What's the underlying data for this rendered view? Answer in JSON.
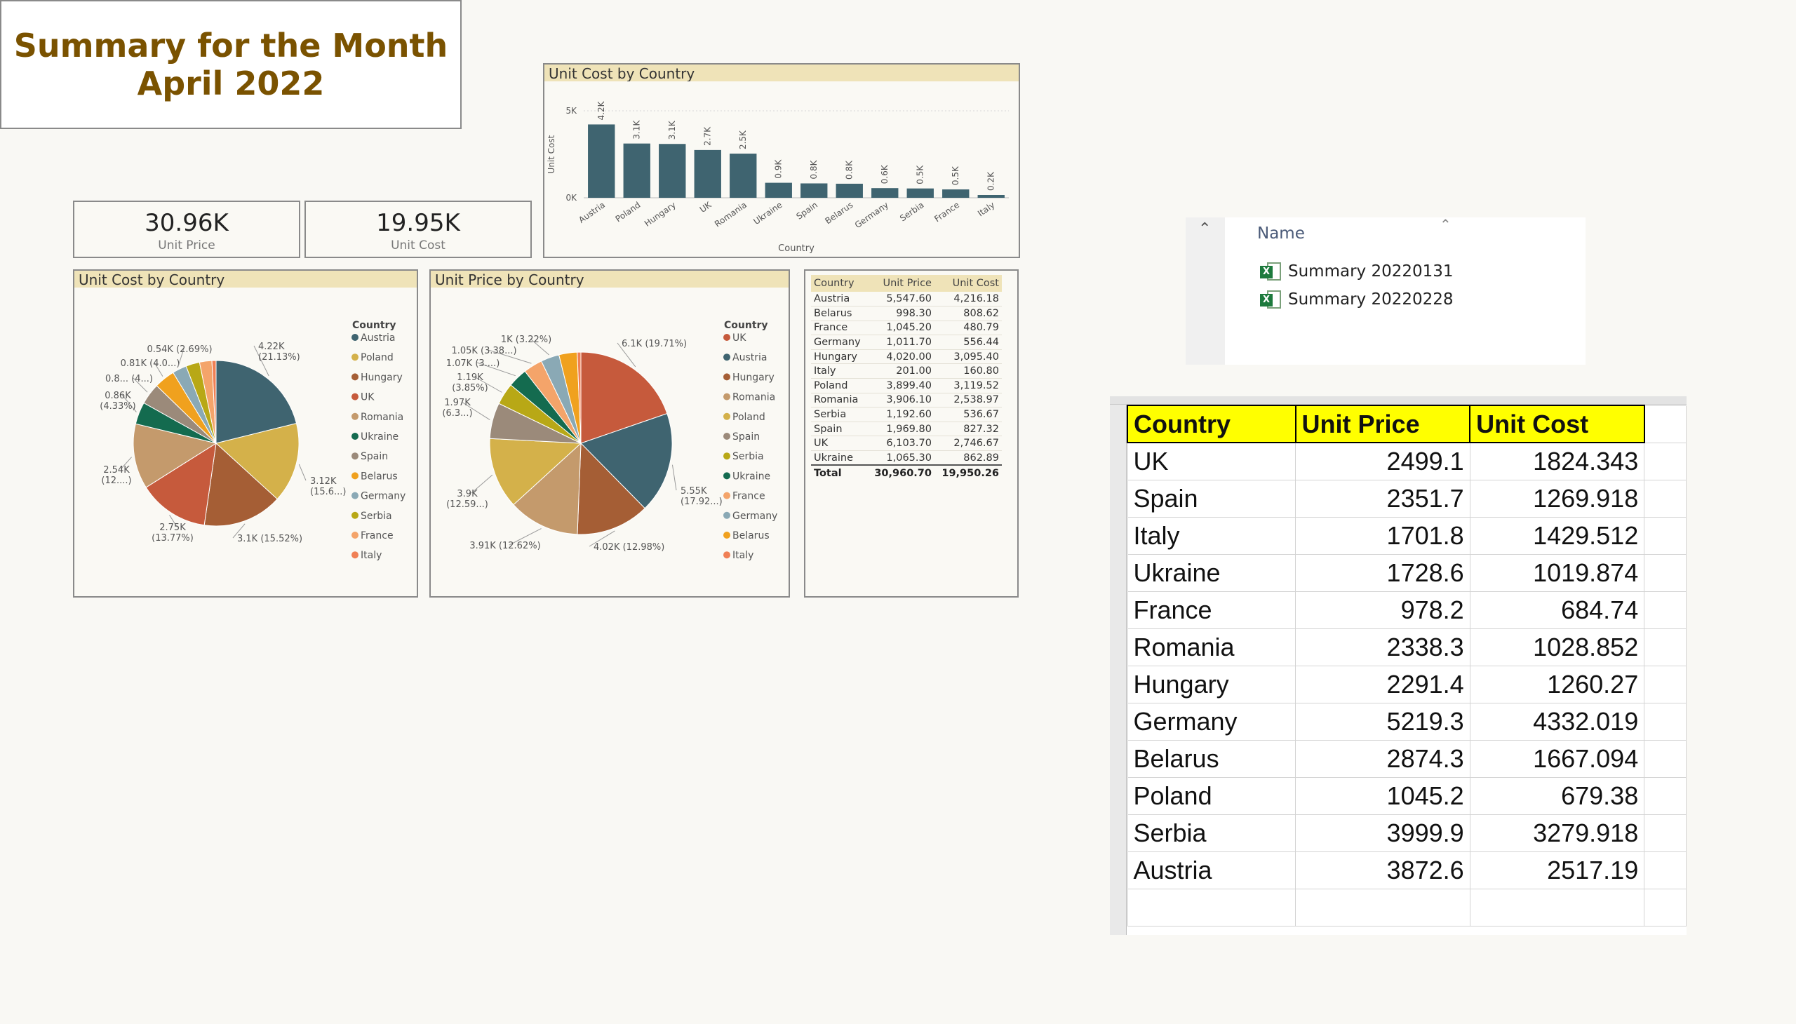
{
  "summary": {
    "title_line1": "Summary for the Month",
    "title_line2": "April 2022",
    "kpis": [
      {
        "value": "30.96K",
        "caption": "Unit Price"
      },
      {
        "value": "19.95K",
        "caption": "Unit Cost"
      }
    ]
  },
  "colors": {
    "Austria": "#3f6470",
    "Poland": "#d4b14a",
    "Hungary": "#a55e35",
    "UK": "#c65a3c",
    "Romania": "#c49a6c",
    "Ukraine": "#146b4f",
    "Spain": "#9b8a7a",
    "Belarus": "#f0a11e",
    "Germany": "#8aa9b5",
    "Serbia": "#b8a816",
    "France": "#f4a46a",
    "Italy": "#f08055"
  },
  "chart_data": [
    {
      "type": "bar",
      "title": "Unit Cost by Country",
      "xlabel": "Country",
      "ylabel": "Unit Cost",
      "yticks": [
        "0K",
        "5K"
      ],
      "ylim": [
        0,
        5000
      ],
      "categories": [
        "Austria",
        "Poland",
        "Hungary",
        "UK",
        "Romania",
        "Ukraine",
        "Spain",
        "Belarus",
        "Germany",
        "Serbia",
        "France",
        "Italy"
      ],
      "values": [
        4216.18,
        3119.52,
        3095.4,
        2746.67,
        2538.97,
        862.89,
        827.32,
        808.62,
        556.44,
        536.67,
        480.79,
        160.8
      ],
      "data_labels": [
        "4.2K",
        "3.1K",
        "3.1K",
        "2.7K",
        "2.5K",
        "0.9K",
        "0.8K",
        "0.8K",
        "0.6K",
        "0.5K",
        "0.5K",
        "0.2K"
      ]
    },
    {
      "type": "pie",
      "title": "Unit Cost by Country",
      "legend_title": "Country",
      "legend_placement": "right",
      "categories": [
        "Austria",
        "Poland",
        "Hungary",
        "UK",
        "Romania",
        "Ukraine",
        "Spain",
        "Belarus",
        "Germany",
        "Serbia",
        "France",
        "Italy"
      ],
      "values": [
        4216.18,
        3119.52,
        3095.4,
        2746.67,
        2538.97,
        862.89,
        827.32,
        808.62,
        556.44,
        536.67,
        480.79,
        160.8
      ],
      "data_labels": [
        {
          "l1": "4.22K",
          "l2": "(21.13%)"
        },
        {
          "l1": "3.12K",
          "l2": "(15.6...)"
        },
        {
          "l1": "3.1K (15.52%)",
          "l2": ""
        },
        {
          "l1": "2.75K",
          "l2": "(13.77%)"
        },
        {
          "l1": "2.54K",
          "l2": "(12....)"
        },
        {
          "l1": "0.86K",
          "l2": "(4.33%)"
        },
        {
          "l1": "0.8... (4...)",
          "l2": ""
        },
        {
          "l1": "0.81K (4.0...)",
          "l2": ""
        },
        {
          "l1": "0.54K (2.69%)",
          "l2": ""
        }
      ]
    },
    {
      "type": "pie",
      "title": "Unit Price by Country",
      "legend_title": "Country",
      "legend_placement": "right",
      "categories": [
        "UK",
        "Austria",
        "Hungary",
        "Romania",
        "Poland",
        "Spain",
        "Serbia",
        "Ukraine",
        "France",
        "Germany",
        "Belarus",
        "Italy"
      ],
      "values": [
        6103.7,
        5547.6,
        4020.0,
        3906.1,
        3899.4,
        1969.8,
        1192.6,
        1065.3,
        1045.2,
        1011.7,
        998.3,
        201.0
      ],
      "data_labels": [
        {
          "l1": "6.1K (19.71%)",
          "l2": ""
        },
        {
          "l1": "5.55K",
          "l2": "(17.92...)"
        },
        {
          "l1": "4.02K (12.98%)",
          "l2": ""
        },
        {
          "l1": "3.91K (12.62%)",
          "l2": ""
        },
        {
          "l1": "3.9K",
          "l2": "(12.59...)"
        },
        {
          "l1": "1.97K",
          "l2": "(6.3...)"
        },
        {
          "l1": "1.19K",
          "l2": "(3.85%)"
        },
        {
          "l1": "1.07K (3....)",
          "l2": ""
        },
        {
          "l1": "1.05K (3.38...)",
          "l2": ""
        },
        {
          "l1": "1K (3.22%)",
          "l2": ""
        }
      ]
    },
    {
      "type": "table",
      "columns": [
        "Country",
        "Unit Price",
        "Unit Cost"
      ],
      "rows": [
        [
          "Austria",
          "5,547.60",
          "4,216.18"
        ],
        [
          "Belarus",
          "998.30",
          "808.62"
        ],
        [
          "France",
          "1,045.20",
          "480.79"
        ],
        [
          "Germany",
          "1,011.70",
          "556.44"
        ],
        [
          "Hungary",
          "4,020.00",
          "3,095.40"
        ],
        [
          "Italy",
          "201.00",
          "160.80"
        ],
        [
          "Poland",
          "3,899.40",
          "3,119.52"
        ],
        [
          "Romania",
          "3,906.10",
          "2,538.97"
        ],
        [
          "Serbia",
          "1,192.60",
          "536.67"
        ],
        [
          "Spain",
          "1,969.80",
          "827.32"
        ],
        [
          "UK",
          "6,103.70",
          "2,746.67"
        ],
        [
          "Ukraine",
          "1,065.30",
          "862.89"
        ]
      ],
      "total": [
        "Total",
        "30,960.70",
        "19,950.26"
      ]
    }
  ],
  "explorer": {
    "column_header": "Name",
    "files": [
      "Summary 20220131",
      "Summary 20220228"
    ]
  },
  "excel": {
    "headers": [
      "Country",
      "Unit Price",
      "Unit Cost"
    ],
    "rows": [
      [
        "UK",
        "2499.1",
        "1824.343"
      ],
      [
        "Spain",
        "2351.7",
        "1269.918"
      ],
      [
        "Italy",
        "1701.8",
        "1429.512"
      ],
      [
        "Ukraine",
        "1728.6",
        "1019.874"
      ],
      [
        "France",
        "978.2",
        "684.74"
      ],
      [
        "Romania",
        "2338.3",
        "1028.852"
      ],
      [
        "Hungary",
        "2291.4",
        "1260.27"
      ],
      [
        "Germany",
        "5219.3",
        "4332.019"
      ],
      [
        "Belarus",
        "2874.3",
        "1667.094"
      ],
      [
        "Poland",
        "1045.2",
        "679.38"
      ],
      [
        "Serbia",
        "3999.9",
        "3279.918"
      ],
      [
        "Austria",
        "3872.6",
        "2517.19"
      ]
    ]
  }
}
